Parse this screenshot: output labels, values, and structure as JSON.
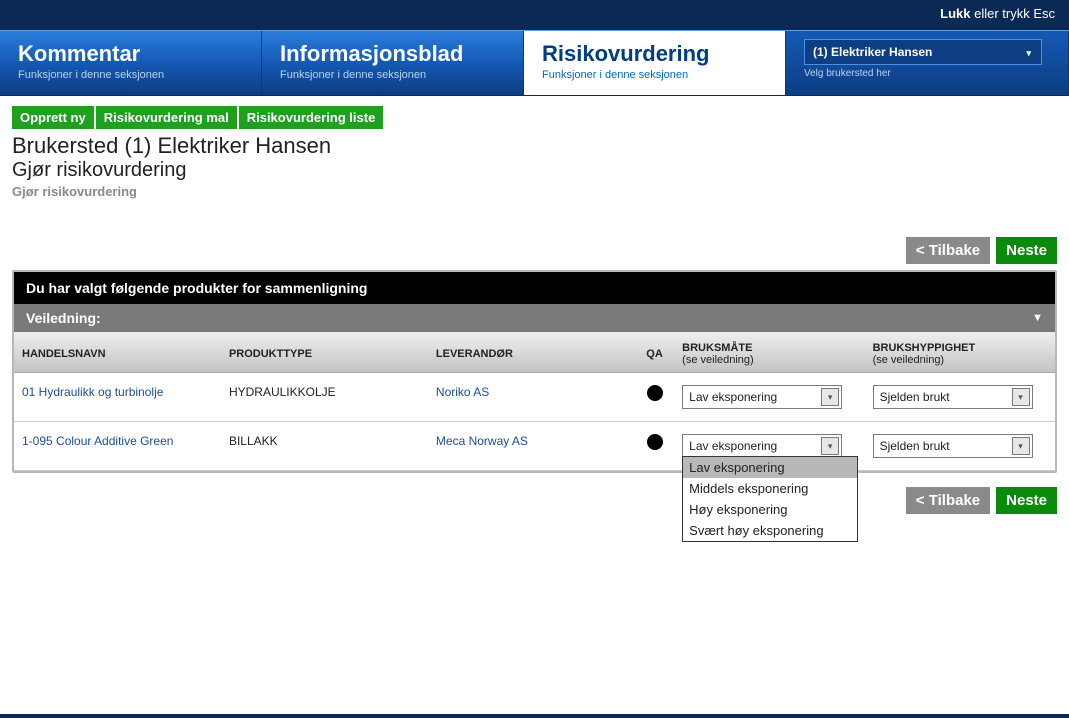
{
  "topbar": {
    "close_bold": "Lukk",
    "close_rest": " eller trykk Esc"
  },
  "tabs": {
    "kommentar": {
      "title": "Kommentar",
      "sub": "Funksjoner i denne seksjonen"
    },
    "info": {
      "title": "Informasjonsblad",
      "sub": "Funksjoner i denne seksjonen"
    },
    "risiko": {
      "title": "Risikovurdering",
      "sub": "Funksjoner i denne seksjonen"
    },
    "user": {
      "selected": "(1) Elektriker Hansen",
      "hint": "Velg brukersted her"
    }
  },
  "actions": {
    "opprett": "Opprett ny",
    "mal": "Risikovurdering mal",
    "liste": "Risikovurdering liste"
  },
  "heading": {
    "line1": "Brukersted (1) Elektriker Hansen",
    "line2": "Gjør risikovurdering",
    "sub": "Gjør risikovurdering"
  },
  "nav": {
    "back": "< Tilbake",
    "next": "Neste"
  },
  "panel": {
    "title": "Du har valgt følgende produkter for sammenligning",
    "guide": "Veiledning:"
  },
  "table": {
    "headers": {
      "hn": "HANDELSNAVN",
      "pt": "PRODUKTTYPE",
      "lv": "LEVERANDØR",
      "qa": "QA",
      "bm": "BRUKSMÅTE",
      "bm_hint": "(se veiledning)",
      "bh": "BRUKSHYPPIGHET",
      "bh_hint": "(se veiledning)"
    },
    "rows": [
      {
        "hn": "01 Hydraulikk og turbinolje",
        "pt": "HYDRAULIKKOLJE",
        "lv": "Noriko AS",
        "bm": "Lav eksponering",
        "bh": "Sjelden brukt"
      },
      {
        "hn": "1-095 Colour Additive Green",
        "pt": "BILLAKK",
        "lv": "Meca Norway AS",
        "bm": "Lav eksponering",
        "bh": "Sjelden brukt"
      }
    ]
  },
  "dd_options_bm": [
    "Lav eksponering",
    "Middels eksponering",
    "Høy eksponering",
    "Svært høy eksponering"
  ]
}
